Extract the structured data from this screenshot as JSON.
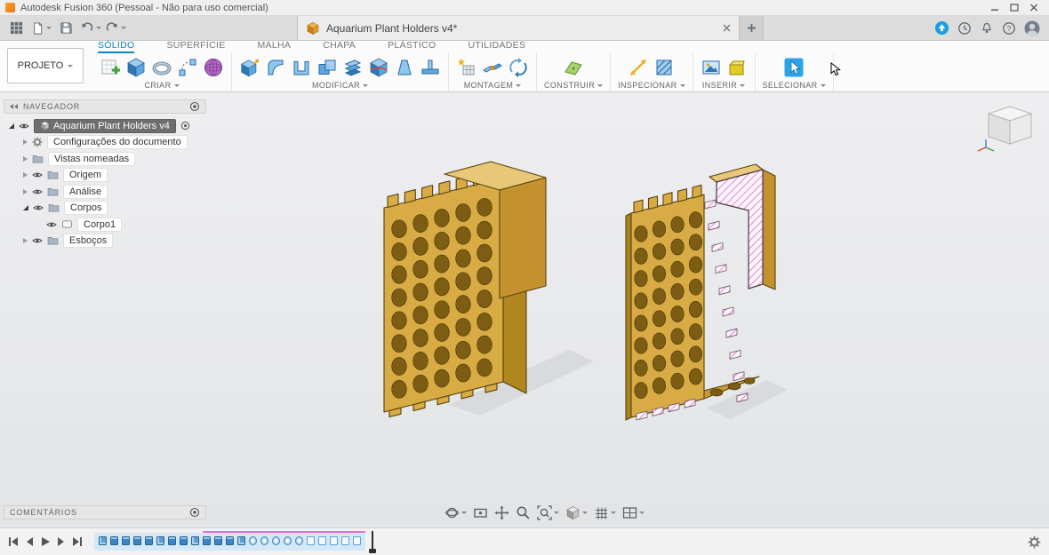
{
  "titlebar": {
    "title": "Autodesk Fusion 360 (Pessoal - Não para uso comercial)"
  },
  "tabbar": {
    "document_tab": "Aquarium Plant Holders v4*"
  },
  "ribbon": {
    "project_label": "PROJETO",
    "tabs": [
      {
        "label": "SÓLIDO",
        "active": true
      },
      {
        "label": "SUPERFÍCIE",
        "active": false
      },
      {
        "label": "MALHA",
        "active": false
      },
      {
        "label": "CHAPA",
        "active": false
      },
      {
        "label": "PLÁSTICO",
        "active": false
      },
      {
        "label": "UTILIDADES",
        "active": false
      }
    ],
    "groups": [
      {
        "label": "CRIAR"
      },
      {
        "label": "MODIFICAR"
      },
      {
        "label": "MONTAGEM"
      },
      {
        "label": "CONSTRUIR"
      },
      {
        "label": "INSPECIONAR"
      },
      {
        "label": "INSERIR"
      },
      {
        "label": "SELECIONAR"
      }
    ]
  },
  "navigator": {
    "header": "NAVEGADOR",
    "root_label": "Aquarium Plant Holders v4",
    "items": [
      {
        "label": "Configurações do documento"
      },
      {
        "label": "Vistas nomeadas"
      },
      {
        "label": "Origem"
      },
      {
        "label": "Análise"
      },
      {
        "label": "Corpos"
      },
      {
        "label": "Corpo1"
      },
      {
        "label": "Esboços"
      }
    ]
  },
  "comments": {
    "header": "COMENTÁRIOS"
  },
  "colors": {
    "accent_blue": "#0a85c7",
    "model_gold": "#d8ab45",
    "section_hatch_pink": "#dd85d4",
    "timeline_blue": "#3b85c6"
  },
  "timeline": {
    "features": [
      "sketch",
      "extrude",
      "extrude",
      "extrude",
      "extrude",
      "sketch",
      "extrude",
      "extrude",
      "sketch",
      "extrude",
      "extrude",
      "extrude",
      "sketch",
      "hole",
      "hole",
      "hole",
      "hole",
      "hole",
      "sketch-outline",
      "sketch-outline",
      "sketch-outline",
      "sketch-outline",
      "sketch-outline"
    ]
  }
}
